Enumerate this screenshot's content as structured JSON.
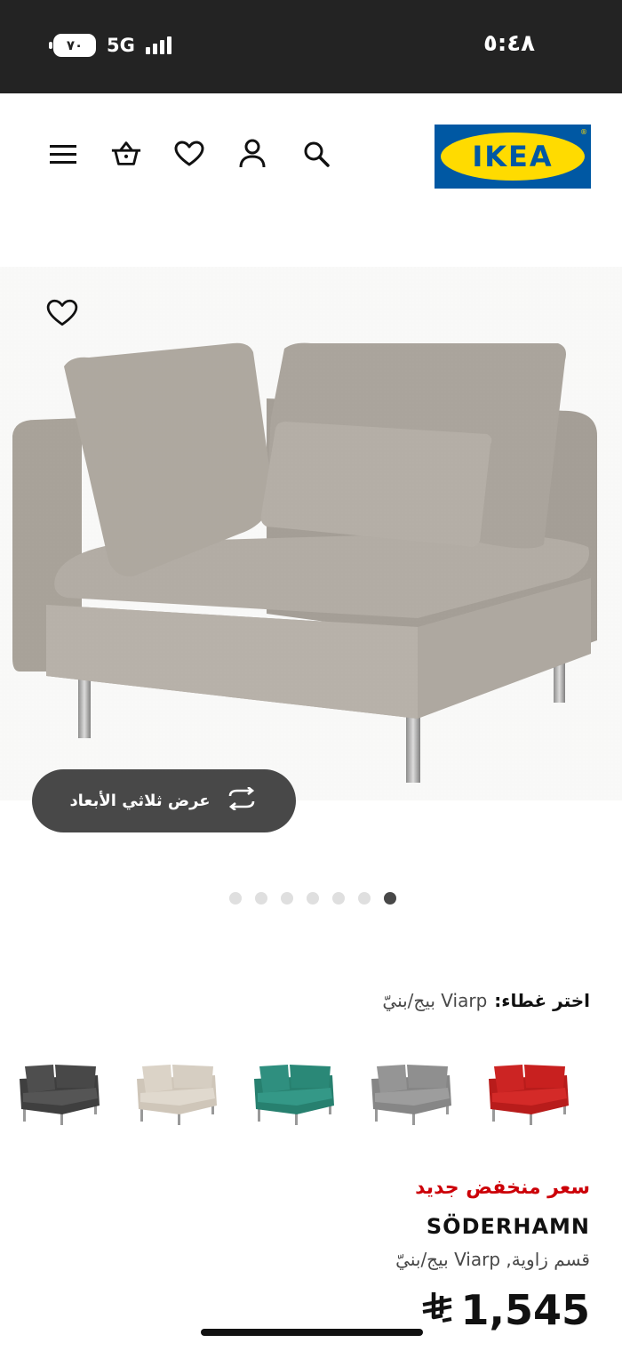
{
  "status_bar": {
    "time": "٥:٤٨",
    "battery": "٧٠",
    "network": "5G"
  },
  "header": {
    "logo_text": "IKEA",
    "icons": [
      "menu-icon",
      "basket-icon",
      "heart-icon",
      "user-icon",
      "search-icon"
    ]
  },
  "gallery": {
    "view_3d_label": "عرض ثلاثي الأبعاد",
    "dot_count": 7,
    "active_dot": 7
  },
  "cover": {
    "label": "اختر غطاء:",
    "selected_value": "Viarp بيج/بنيّ",
    "swatches": [
      {
        "name": "dark-grey",
        "color": "#4a4a4a"
      },
      {
        "name": "beige",
        "color": "#d6cec2"
      },
      {
        "name": "green",
        "color": "#2f8f7f"
      },
      {
        "name": "grey",
        "color": "#8f8f8f"
      },
      {
        "name": "red",
        "color": "#c8201f"
      }
    ]
  },
  "product": {
    "promo": "سعر منخفض جديد",
    "name": "SÖDERHAMN",
    "description": "قسم زاوية, Viarp بيج/بنيّ",
    "price": "1,545"
  },
  "colors": {
    "ikea_blue": "#0058a3",
    "ikea_yellow": "#ffdb00",
    "promo_red": "#cc0008"
  }
}
